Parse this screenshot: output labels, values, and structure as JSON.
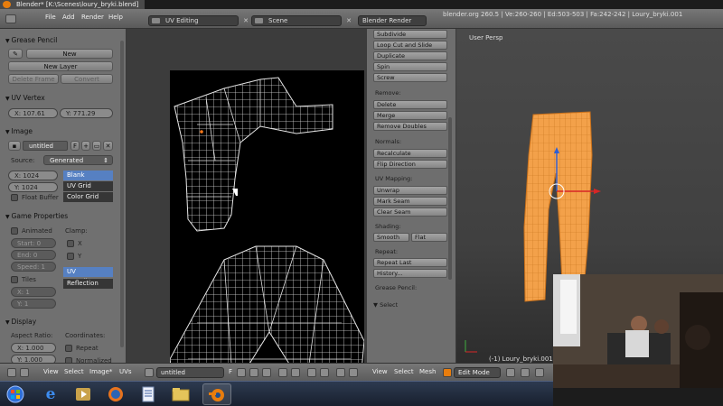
{
  "window": {
    "title": "Blender* [K:\\Scenes\\loury_bryki.blend]"
  },
  "header": {
    "menus": [
      "File",
      "Add",
      "Render",
      "Help"
    ],
    "layout": "UV Editing",
    "scene": "Scene",
    "engine": "Blender Render",
    "stats": "blender.org 260.5 | Ve:260-260 | Ed:503-503 | Fa:242-242 | Loury_bryki.001"
  },
  "left_panel": {
    "grease_pencil": {
      "title": "Grease Pencil",
      "new": "New",
      "new_layer": "New Layer",
      "delete_frame": "Delete Frame",
      "convert": "Convert"
    },
    "uv_vertex": {
      "title": "UV Vertex",
      "x": "X: 107.61",
      "y": "Y: 771.29"
    },
    "image": {
      "title": "Image",
      "name": "untitled",
      "f_label": "F",
      "source_label": "Source:",
      "source_value": "Generated",
      "x": "X: 1024",
      "y": "Y: 1024",
      "float_buffer": "Float Buffer",
      "types": [
        "Blank",
        "UV Grid",
        "Color Grid"
      ],
      "selected_type": "Blank"
    },
    "game_properties": {
      "title": "Game Properties",
      "animated": "Animated",
      "clamp": "Clamp:",
      "clamp_x": "X",
      "clamp_y": "Y",
      "start": "Start: 0",
      "end": "End: 0",
      "speed": "Speed: 1",
      "tiles": "Tiles",
      "tile_x": "X: 1",
      "tile_y": "Y: 1",
      "mapping": [
        "UV Coordinates",
        "Reflection"
      ],
      "selected_mapping": "UV Coordinates"
    },
    "display": {
      "title": "Display",
      "aspect_ratio": "Aspect Ratio:",
      "coordinates": "Coordinates:",
      "x": "X: 1.000",
      "y": "Y: 1.000",
      "repeat": "Repeat",
      "normalized": "Normalized"
    }
  },
  "tool_shelf": {
    "add_buttons": [
      "Subdivide",
      "Loop Cut and Slide",
      "Duplicate",
      "Spin",
      "Screw"
    ],
    "remove_title": "Remove:",
    "remove_buttons": [
      "Delete",
      "Merge",
      "Remove Doubles"
    ],
    "normals_title": "Normals:",
    "normals_buttons": [
      "Recalculate",
      "Flip Direction"
    ],
    "uv_title": "UV Mapping:",
    "uv_buttons": [
      "Unwrap",
      "Mark Seam",
      "Clear Seam"
    ],
    "shading_title": "Shading:",
    "smooth": "Smooth",
    "flat": "Flat",
    "repeat_title": "Repeat:",
    "repeat_buttons": [
      "Repeat Last",
      "History..."
    ],
    "grease_title": "Grease Pencil:",
    "select_title": "Select"
  },
  "viewport": {
    "view_label": "User Persp",
    "object_label": "(-1) Loury_bryki.001"
  },
  "uv_bottom": {
    "menus": [
      "View",
      "Select",
      "Image*",
      "UVs"
    ],
    "image_name": "untitled",
    "f_label": "F"
  },
  "vp_bottom": {
    "menus": [
      "View",
      "Select",
      "Mesh"
    ],
    "mode": "Edit Mode"
  },
  "taskbar": {
    "items": [
      "start-orb",
      "internet-explorer",
      "media-player",
      "firefox",
      "document-editor",
      "file-explorer",
      "blender"
    ],
    "active": "blender"
  },
  "colors": {
    "accent_orange": "#e87d0d",
    "selection_blue": "#5680c2",
    "mesh_orange": "#f3a14a"
  }
}
